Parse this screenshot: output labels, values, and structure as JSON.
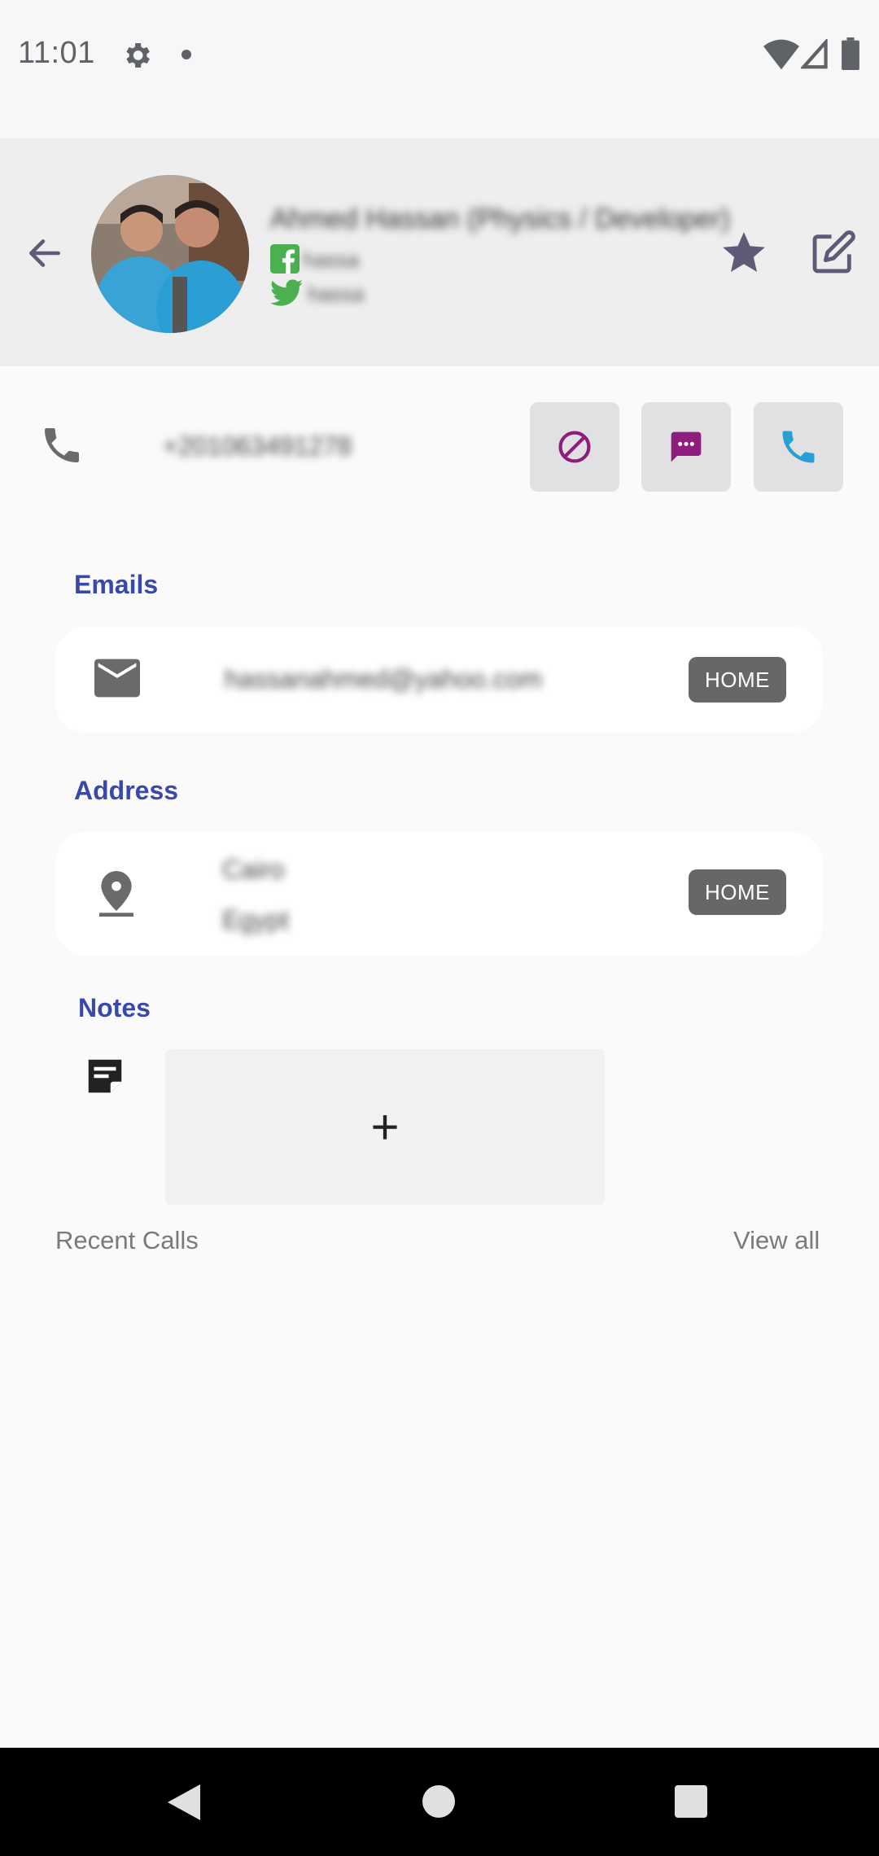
{
  "status_bar": {
    "time": "11:01",
    "icons": [
      "settings-icon",
      "notification-dot-icon",
      "wifi-icon",
      "signal-icon",
      "battery-icon"
    ]
  },
  "contact": {
    "name": "Ahmed Hassan (Physics / Developer)",
    "facebook_handle": "hassa",
    "twitter_handle": "hassa",
    "phone": "+201063491278"
  },
  "emails_section": {
    "title": "Emails",
    "items": [
      {
        "value": "hassanahmed@yahoo.com",
        "tag": "HOME"
      }
    ]
  },
  "address_section": {
    "title": "Address",
    "items": [
      {
        "line1": "Cairo",
        "line2": "Egypt",
        "tag": "HOME"
      }
    ]
  },
  "notes_section": {
    "title": "Notes",
    "add_label": "+"
  },
  "recent_calls": {
    "title": "Recent Calls",
    "view_all": "View all"
  },
  "colors": {
    "accent_purple": "#5e5a78",
    "section_blue": "#3949ab",
    "message_magenta": "#8e1d7e",
    "call_blue": "#2a9fd6",
    "facebook_green": "#4caf50"
  }
}
